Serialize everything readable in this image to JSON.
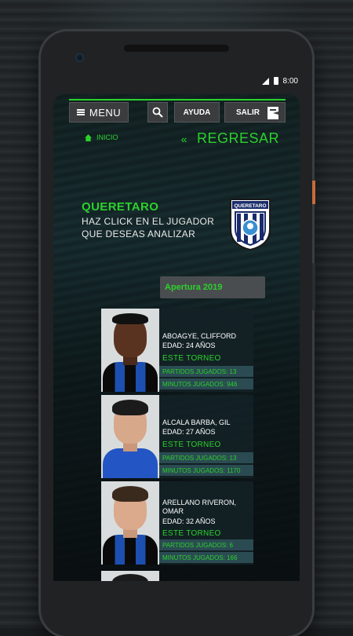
{
  "status_bar": {
    "time": "8:00",
    "signal_icon": "signal-icon",
    "battery_icon": "battery-icon"
  },
  "colors": {
    "accent": "#2bd12b",
    "button_bg": "#3a3c3e",
    "card_bg": "#142226",
    "stat_bg": "#30545a"
  },
  "nav": {
    "menu_label": "MENU",
    "menu_icon": "hamburger-icon",
    "search_icon": "search-icon",
    "help_label": "AYUDA",
    "logout_label": "SALIR"
  },
  "breadcrumb": {
    "home_label": "INICIO",
    "home_icon": "home-icon",
    "back_chevron": "«",
    "back_label": "REGRESAR"
  },
  "team": {
    "name": "QUERETARO",
    "instruction_line1": "HAZ CLICK EN EL JUGADOR",
    "instruction_line2": "QUE DESEAS ANALIZAR",
    "crest_text": "QUERETARO"
  },
  "season_selector": {
    "value": "Apertura 2019"
  },
  "players": [
    {
      "name": "ABOAGYE, CLIFFORD",
      "age": "EDAD: 24 AÑOS",
      "section": "ESTE TORNEO",
      "matches": "PARTIDOS JUGADOS: 13",
      "minutes": "MINUTOS JUGADOS: 946"
    },
    {
      "name": "ALCALA BARBA, GIL",
      "age": "EDAD: 27 AÑOS",
      "section": "ESTE TORNEO",
      "matches": "PARTIDOS JUGADOS: 13",
      "minutes": "MINUTOS JUGADOS: 1170"
    },
    {
      "name": "ARELLANO RIVERON, OMAR",
      "age": "EDAD: 32 AÑOS",
      "section": "ESTE TORNEO",
      "matches": "PARTIDOS JUGADOS: 6",
      "minutes": "MINUTOS JUGADOS: 166"
    }
  ]
}
